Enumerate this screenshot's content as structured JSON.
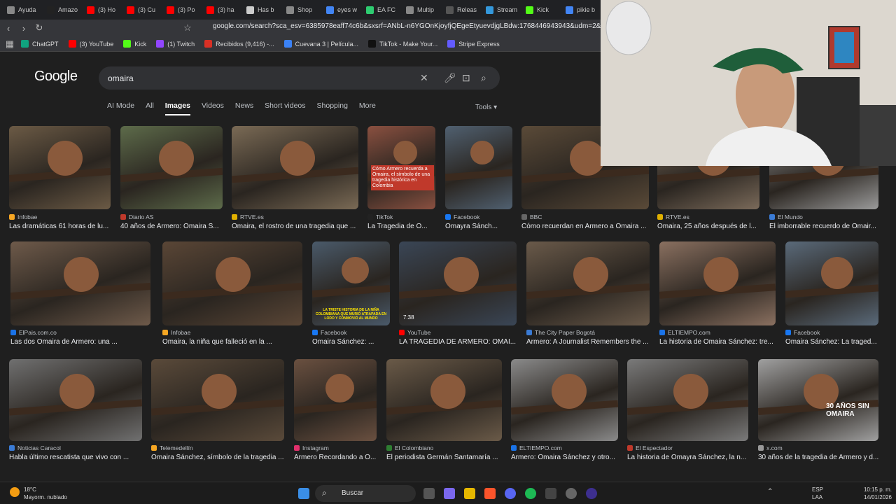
{
  "browser": {
    "tabs": [
      "Ayuda",
      "Amazo",
      "(3) Ho",
      "(3) Cu",
      "(3) Po",
      "(3) ha",
      "Has b",
      "Shop",
      "eyes w",
      "EA FC",
      "Multip",
      "Releas",
      "Stream",
      "Kick",
      "pikie b"
    ],
    "url": "google.com/search?sca_esv=6385978eaff74c6b&sxsrf=ANbL-n6YGOnKjoyfjQEgeEtyuevdjgLBdw:1768446943943&udm=2&fbs=ADc_l-",
    "bookmarks": [
      "ChatGPT",
      "(3) YouTube",
      "Kick",
      "(1) Twitch",
      "Recibidos (9,416) -...",
      "Cuevana 3 | Película...",
      "TikTok - Make Your...",
      "Stripe Express"
    ]
  },
  "google": {
    "logo": "Google",
    "query": "omaira",
    "filters": [
      "AI Mode",
      "All",
      "Images",
      "Videos",
      "News",
      "Short videos",
      "Shopping",
      "More"
    ],
    "active_filter": "Images",
    "tools": "Tools"
  },
  "results": {
    "row1": [
      {
        "source": "Infobae",
        "title": "Las dramáticas 61 horas de lu...",
        "color": "#f5a623"
      },
      {
        "source": "Diario AS",
        "title": "40 años de Armero: Omaira S...",
        "color": "#c0392b"
      },
      {
        "source": "RTVE.es",
        "title": "Omaira, el rostro de una tragedia que ...",
        "color": "#e0b000"
      },
      {
        "source": "TikTok",
        "title": "La Tragedia de O...",
        "color": "#222"
      },
      {
        "source": "Facebook",
        "title": "Omayra Sánch...",
        "color": "#1877f2"
      },
      {
        "source": "BBC",
        "title": "Cómo recuerdan en Armero a Omaira ...",
        "color": "#666"
      },
      {
        "source": "RTVE.es",
        "title": "Omaira, 25 años después de l...",
        "color": "#e0b000"
      },
      {
        "source": "El Mundo",
        "title": "El imborrable recuerdo de Omair...",
        "color": "#3a7bd5"
      }
    ],
    "row2": [
      {
        "source": "ElPais.com.co",
        "title": "Las dos Omaira de Armero: una ...",
        "color": "#1a73e8"
      },
      {
        "source": "Infobae",
        "title": "Omaira, la niña que falleció en la ...",
        "color": "#f5a623"
      },
      {
        "source": "Facebook",
        "title": "Omaira Sánchez: ...",
        "color": "#1877f2"
      },
      {
        "source": "YouTube",
        "title": "LA TRAGEDIA DE ARMERO: OMAI...",
        "color": "#ff0000",
        "duration": "7:38"
      },
      {
        "source": "The City Paper Bogotá",
        "title": "Armero: A Journalist Remembers the ...",
        "color": "#3a7bd5"
      },
      {
        "source": "ELTIEMPO.com",
        "title": "La historia de Omaira Sánchez: tre...",
        "color": "#1a73e8"
      },
      {
        "source": "Facebook",
        "title": "Omaira Sánchez: La traged...",
        "color": "#1877f2"
      }
    ],
    "row3": [
      {
        "source": "Noticias Caracol",
        "title": "Habla último rescatista que vivo con ...",
        "color": "#3a7bd5"
      },
      {
        "source": "Telemedellín",
        "title": "Omaira Sánchez, símbolo de la tragedia ...",
        "color": "#f5a623"
      },
      {
        "source": "Instagram",
        "title": "Armero Recordando a O...",
        "color": "#e1306c"
      },
      {
        "source": "El Colombiano",
        "title": "El periodista Germán Santamaría ...",
        "color": "#2e7d32"
      },
      {
        "source": "ELTIEMPO.com",
        "title": "Armero: Omaira Sánchez y otro...",
        "color": "#1a73e8"
      },
      {
        "source": "El Espectador",
        "title": "La historia de Omayra Sánchez, la n...",
        "color": "#c0392b"
      },
      {
        "source": "x.com",
        "title": "30 años de la tragedia de Armero y d...",
        "color": "#999"
      }
    ]
  },
  "tiktok_overlay": "Cómo Armero recuerda a Omaira, el símbolo de una tragedia histórica en Colombia",
  "magazine_overlay": "30 AÑOS SIN OMAIRA",
  "fb_caption": "LA TRISTE HISTORIA DE LA NIÑA COLOMBIANA QUE MURIÓ ATRAPADA EN LODO Y CONMOVIÓ AL MUNDO",
  "taskbar": {
    "weather_temp": "18°C",
    "weather_desc": "Mayorm. nublado",
    "search": "Buscar",
    "lang1": "ESP",
    "lang2": "LAA",
    "time": "10:15 p. m.",
    "date": "14/01/2026"
  }
}
